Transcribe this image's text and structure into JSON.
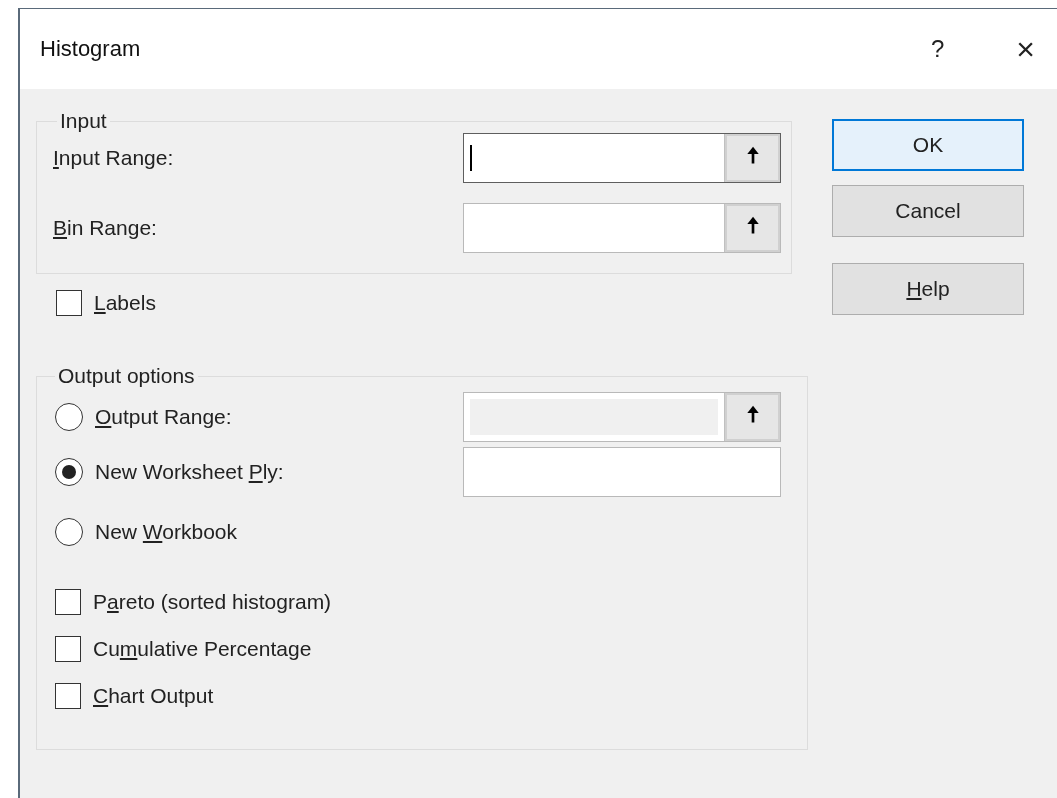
{
  "window": {
    "title": "Histogram",
    "help_button": "?",
    "close_button": "×"
  },
  "input_group": {
    "legend": "Input",
    "fields": [
      {
        "mnemonic": "I",
        "label_rest": "nput Range:",
        "focused": true,
        "disabled": false,
        "picker": "🠅"
      },
      {
        "mnemonic": "B",
        "label_rest": "in Range:",
        "focused": false,
        "disabled": false,
        "picker": "🠅"
      }
    ]
  },
  "labels_checkbox": {
    "mnemonic": "L",
    "label_rest": "abels",
    "checked": false
  },
  "output_group": {
    "legend": "Output options",
    "options": [
      {
        "mnemonic": "O",
        "label_rest": "utput Range:",
        "selected": false,
        "field": {
          "disabled": true,
          "picker": "🠅"
        }
      },
      {
        "label_start": "New Worksheet ",
        "mnemonic": "P",
        "label_rest": "ly:",
        "selected": true,
        "field": {
          "disabled": false
        }
      },
      {
        "label_start": "New ",
        "mnemonic": "W",
        "label_rest": "orkbook",
        "selected": false
      }
    ],
    "checkboxes": [
      {
        "label_start": "P",
        "mnemonic": "a",
        "label_rest": "reto (sorted histogram)",
        "checked": false
      },
      {
        "label_start": "Cu",
        "mnemonic": "m",
        "label_rest": "ulative Percentage",
        "checked": false
      },
      {
        "mnemonic": "C",
        "label_rest": "hart Output",
        "checked": false
      }
    ]
  },
  "buttons": [
    {
      "label_rest": "OK",
      "default": true
    },
    {
      "label_rest": "Cancel",
      "default": false
    },
    {
      "mnemonic": "H",
      "label_rest": "elp",
      "default": false
    }
  ]
}
